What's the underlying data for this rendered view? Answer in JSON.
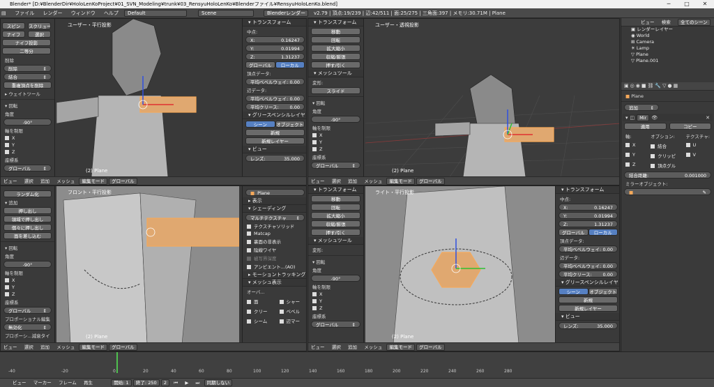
{
  "titlebar": {
    "title": "Blender* [D:¥BlenderDir¥HoloLenKoProject¥01_SVN_Modeling¥trunk¥03_RensyuHoloLenKo¥Blenderファイル¥RensyuHoloLenKo.blend]",
    "minimize": "─",
    "maximize": "□",
    "close": "✕"
  },
  "menubar": {
    "items": [
      "ファイル",
      "レンダー",
      "ウィンドウ",
      "ヘルプ"
    ],
    "layout": "Default",
    "scene": "Scene",
    "engine": "Blenderレンダー",
    "stats": "v2.79 | 頂点:19/239 | 辺:42/511 | 面:25/275 | 三角面:397 | メモリ:30.71M | Plane"
  },
  "toolshelf": {
    "buttons_top": [
      "スピン",
      "スクリュー",
      "ナイフ",
      "選択",
      "ナイフ投影",
      "二等分"
    ],
    "delete_label": "削除",
    "delete": "削除",
    "merge": "結合",
    "remove_doubles": "重複頂点を削除",
    "weight_tool": "ウェイトツール",
    "random": "ランダム化",
    "extrude": "押し出し",
    "extrude_region": "領域で押し出し",
    "extrude_individual": "個々に押し出し",
    "inset": "面を差し込む"
  },
  "operator_panel": {
    "title": "回転",
    "angle_label": "角度",
    "angle": "-90°",
    "axis_label": "軸を制限",
    "x": "X",
    "y": "Y",
    "z": "Z",
    "orient_label": "座標系",
    "orient": "グローバル",
    "prop_edit_label": "プロポーショナル編集",
    "prop_edit": "無効化",
    "falloff": "プロポーシ...減衰タイ"
  },
  "transform_panel": {
    "title": "トランスフォーム",
    "median": "中点:",
    "x": "0.16247",
    "y": "0.01994",
    "z": "1.31237",
    "global": "グローバル",
    "local": "ローカル",
    "vertex_data": "頂点データ:",
    "mean_bevel_weight": "平均ベベルウェイ:",
    "mean_bevel_val": "0.00",
    "edge_data": "辺データ:",
    "edge_bevel_val": "0.00",
    "mean_crease": "平均クリース:",
    "crease_val": "0.00",
    "grease_pencil": "グリースペンシルレイヤー",
    "scene": "シーン",
    "object": "オブジェクト",
    "new": "新規",
    "new_layer": "新規レイヤー",
    "view": "ビュー",
    "lens": "レンズ:",
    "lens_val": "35.000"
  },
  "mesh_tools": {
    "title": "トランスフォーム",
    "items": [
      "移動",
      "回転",
      "拡大縮小",
      "収縮/膨張",
      "押す/引く"
    ],
    "mesh_tool_title": "メッシュツール",
    "deform": "変形:",
    "slide": "スライド"
  },
  "viewports": {
    "top_left_label": "ユーザー・平行投影",
    "top_right_label": "ユーザー・透視投影",
    "bottom_left_label": "フロント・平行投影",
    "bottom_right_label": "ライト・平行投影",
    "object_name": "(2) Plane"
  },
  "header3d": {
    "view": "ビュー",
    "select": "選択",
    "add": "追加",
    "mesh": "メッシュ",
    "mode": "編集モード",
    "orientation": "グローバル"
  },
  "display_panel": {
    "object": "Plane",
    "display": "表示",
    "shading": "シェーディング",
    "shading_mode": "マルチテクスチャ",
    "textured_solid": "テクスチャソリッド",
    "matcap": "Matcap",
    "backface": "裏面の非表示",
    "hidden_wire": "陰線ワイヤ",
    "depth_of_field": "被写界深度",
    "ao": "アンビエント...(AO)",
    "motion_tracking": "モーショントラッキング",
    "mesh_display": "メッシュ表示",
    "overlays": "オーバ...",
    "face": "面",
    "crease": "クリー",
    "seam": "シーム",
    "sharp": "シャー",
    "bevel": "ベベル",
    "edge_marks": "辺マー",
    "face_marks": "面マー"
  },
  "outliner": {
    "menu_view": "ビュー",
    "menu_search": "検索",
    "filter": "全てのシーン",
    "rows": [
      "RenderLayers",
      "World",
      "Camera",
      "Lamp",
      "Plane",
      "Plane.001"
    ],
    "renderlayer_label": "レンダーレイヤー"
  },
  "properties": {
    "object": "Plane",
    "add_modifier": "追加",
    "modifier_name": "Mir",
    "apply": "適用",
    "copy": "コピー",
    "axis": "軸:",
    "options": "オプション:",
    "texture": "テクスチャ:",
    "x": "X",
    "y": "Y",
    "z": "Z",
    "merge": "結合",
    "clipping": "クリッピ",
    "vertex_group": "頂点グル",
    "u": "U",
    "v": "V",
    "merge_limit_label": "結合距離:",
    "merge_limit": "0.001000",
    "mirror_object": "ミラーオブジェクト:"
  },
  "timeline": {
    "ticks": [
      "-40",
      "-20",
      "0",
      "20",
      "40",
      "60",
      "80",
      "100",
      "120",
      "140",
      "160",
      "180",
      "200",
      "220",
      "240",
      "260",
      "280"
    ],
    "view": "ビュー",
    "marker": "マーカー",
    "frame": "フレーム",
    "playback": "再生",
    "start_label": "開始:",
    "start": "1",
    "end_label": "終了:",
    "end": "250",
    "current": "2",
    "sync": "同期しない"
  },
  "colors": {
    "accent_blue": "#5680c2",
    "selection_orange": "#f5a95a",
    "viewport_bg": "#393939"
  }
}
